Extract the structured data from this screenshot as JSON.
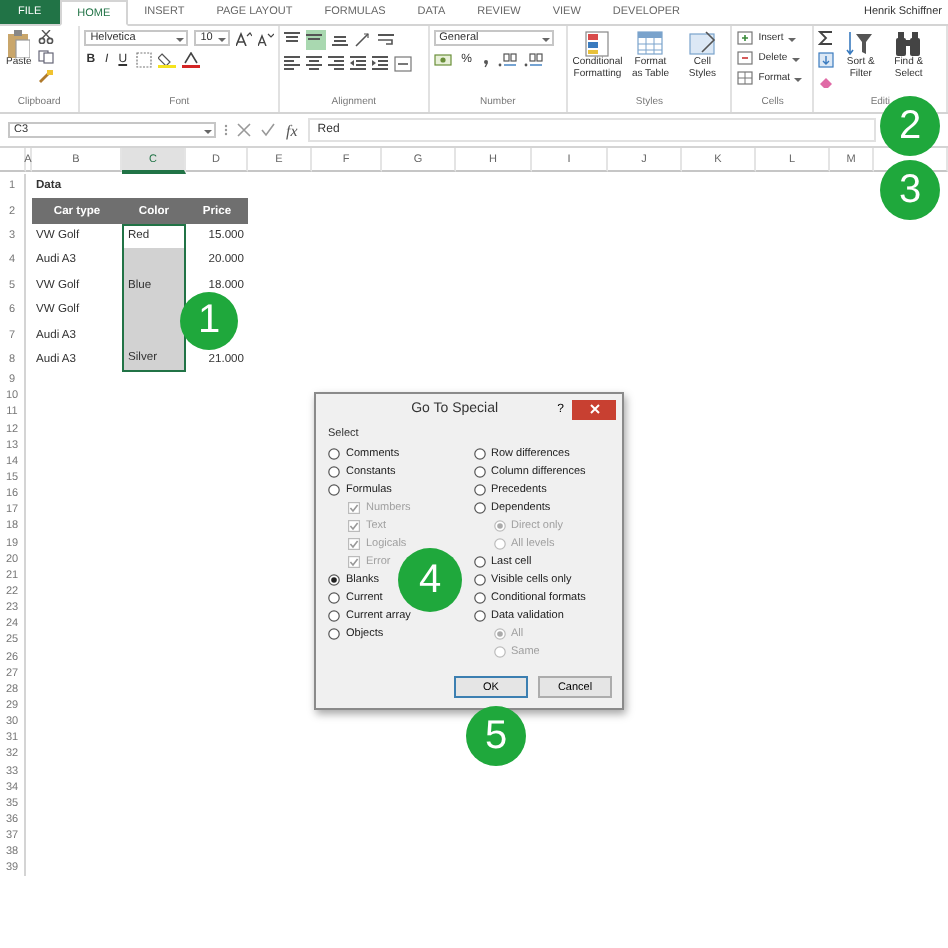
{
  "ribbon": {
    "tabs": [
      {
        "label": "FILE",
        "kind": "file",
        "selected": false
      },
      {
        "label": "HOME",
        "kind": "tab",
        "selected": true
      },
      {
        "label": "INSERT",
        "kind": "tab",
        "selected": false
      },
      {
        "label": "PAGE LAYOUT",
        "kind": "tab",
        "selected": false
      },
      {
        "label": "FORMULAS",
        "kind": "tab",
        "selected": false
      },
      {
        "label": "DATA",
        "kind": "tab",
        "selected": false
      },
      {
        "label": "REVIEW",
        "kind": "tab",
        "selected": false
      },
      {
        "label": "VIEW",
        "kind": "tab",
        "selected": false
      },
      {
        "label": "DEVELOPER",
        "kind": "tab",
        "selected": false
      }
    ],
    "user": "Henrik Schiffner",
    "groups": [
      {
        "label": "Clipboard",
        "kind": "clipboard",
        "paste": "Paste"
      },
      {
        "label": "Font",
        "kind": "font",
        "font": "Helvetica",
        "size": "10",
        "bold": "B",
        "italic": "I",
        "underline": "U"
      },
      {
        "label": "Alignment",
        "kind": "alignment"
      },
      {
        "label": "Number",
        "kind": "number",
        "format": "General",
        "percent": "%"
      },
      {
        "label": "Styles",
        "kind": "styles",
        "buttons": [
          "Conditional Formatting",
          "Format as Table",
          "Cell Styles"
        ]
      },
      {
        "label": "Cells",
        "kind": "cells",
        "buttons": [
          "Insert",
          "Delete",
          "Format"
        ]
      },
      {
        "label": "Editi",
        "kind": "editing",
        "buttons": [
          "Sort & Filter",
          "Find & Select"
        ]
      }
    ]
  },
  "formula_bar": {
    "name_box": "C3",
    "function_label": "fx",
    "formula": "Red"
  },
  "sheet": {
    "columns": [
      "A",
      "B",
      "C",
      "D",
      "E",
      "F",
      "G",
      "H",
      "I",
      "J",
      "K",
      "L",
      "M"
    ],
    "row_numbers": [
      "1",
      "2",
      "3",
      "4",
      "5",
      "6",
      "7",
      "8",
      "9",
      "10",
      "11",
      "12",
      "13",
      "14",
      "15",
      "16",
      "17",
      "18",
      "19",
      "20",
      "21",
      "22",
      "23",
      "24",
      "25",
      "26",
      "27",
      "28",
      "29",
      "30",
      "31",
      "32",
      "33",
      "34",
      "35",
      "36",
      "37",
      "38",
      "39"
    ],
    "title_cell": "Data",
    "header": [
      "Car type",
      "Color",
      "Price"
    ],
    "rows": [
      {
        "car": "VW Golf",
        "color": {
          "text": "Red",
          "selected": true,
          "active": true
        },
        "price": "15.000"
      },
      {
        "car": "Audi A3",
        "color": {
          "selected": true,
          "active": false
        },
        "price": "20.000"
      },
      {
        "car": "VW Golf",
        "color": {
          "text": "Blue",
          "selected": true,
          "active": false
        },
        "price": "18.000"
      },
      {
        "car": "VW Golf",
        "color": {
          "selected": true,
          "active": false
        }
      },
      {
        "car": "Audi A3",
        "color": {
          "selected": true,
          "active": false
        }
      },
      {
        "car": "Audi A3",
        "color": {
          "text": "Silver",
          "selected": true,
          "active": false
        },
        "price": "21.000"
      }
    ]
  },
  "dialog": {
    "title": "Go To Special",
    "help": "?",
    "group_label": "Select",
    "columns": [
      [
        {
          "label": "Comments",
          "kind": "radio",
          "selected": false,
          "disabled": false
        },
        {
          "label": "Constants",
          "kind": "radio",
          "selected": false,
          "disabled": false
        },
        {
          "label": "Formulas",
          "kind": "radio",
          "selected": false,
          "disabled": false,
          "children": [
            {
              "label": "Numbers",
              "kind": "check",
              "checked": true,
              "disabled": true
            },
            {
              "label": "Text",
              "kind": "check",
              "checked": true,
              "disabled": true
            },
            {
              "label": "Logicals",
              "kind": "check",
              "checked": true,
              "disabled": true
            },
            {
              "label": "Error",
              "kind": "check",
              "checked": true,
              "disabled": true
            }
          ]
        },
        {
          "label": "Blanks",
          "kind": "radio",
          "selected": true,
          "disabled": false
        },
        {
          "label": "Current",
          "kind": "radio",
          "selected": false,
          "disabled": false
        },
        {
          "label": "Current array",
          "kind": "radio",
          "selected": false,
          "disabled": false
        },
        {
          "label": "Objects",
          "kind": "radio",
          "selected": false,
          "disabled": false
        }
      ],
      [
        {
          "label": "Row differences",
          "kind": "radio",
          "selected": false,
          "disabled": false
        },
        {
          "label": "Column differences",
          "kind": "radio",
          "selected": false,
          "disabled": false
        },
        {
          "label": "Precedents",
          "kind": "radio",
          "selected": false,
          "disabled": false
        },
        {
          "label": "Dependents",
          "kind": "radio",
          "selected": false,
          "disabled": false,
          "children": [
            {
              "label": "Direct only",
              "kind": "radio",
              "selected": true,
              "disabled": true
            },
            {
              "label": "All levels",
              "kind": "radio",
              "selected": false,
              "disabled": true
            }
          ]
        },
        {
          "label": "Last cell",
          "kind": "radio",
          "selected": false,
          "disabled": false
        },
        {
          "label": "Visible cells only",
          "kind": "radio",
          "selected": false,
          "disabled": false
        },
        {
          "label": "Conditional formats",
          "kind": "radio",
          "selected": false,
          "disabled": false
        },
        {
          "label": "Data validation",
          "kind": "radio",
          "selected": false,
          "disabled": false,
          "children": [
            {
              "label": "All",
              "kind": "radio",
              "selected": true,
              "disabled": true
            },
            {
              "label": "Same",
              "kind": "radio",
              "selected": false,
              "disabled": true
            }
          ]
        }
      ]
    ],
    "buttons": [
      {
        "label": "OK",
        "default": true
      },
      {
        "label": "Cancel",
        "default": false
      }
    ]
  },
  "callouts": [
    {
      "label": "1"
    },
    {
      "label": "2"
    },
    {
      "label": "3"
    },
    {
      "label": "4"
    },
    {
      "label": "5"
    }
  ]
}
